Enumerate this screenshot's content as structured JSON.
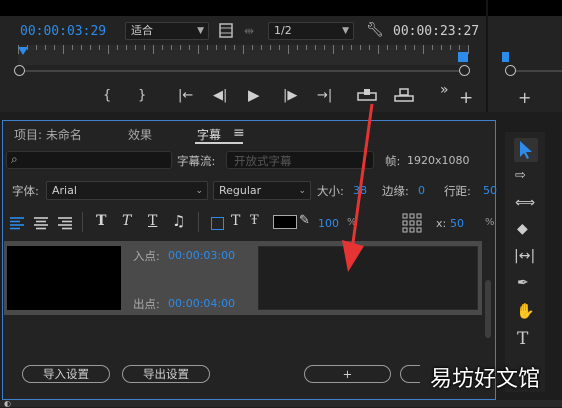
{
  "monitor": {
    "current_time": "00:00:03:29",
    "fit_select": "适合",
    "resolution_select": "1/2",
    "duration": "00:00:23:27"
  },
  "transport": {
    "mark_in": "{",
    "mark_out": "}",
    "go_to_in": "|←",
    "step_back": "◀|",
    "play": "▶",
    "step_forward": "|▶",
    "go_to_out": "→|",
    "more": "»",
    "add": "+"
  },
  "panel": {
    "tabs": [
      "项目: 未命名",
      "效果",
      "字幕"
    ],
    "menu_icon": "≡",
    "caption_stream_label": "字幕流:",
    "caption_stream_value": "开放式字幕",
    "frame_label": "帧:",
    "frame_value": "1920x1080",
    "font_label": "字体:",
    "font_value": "Arial",
    "style_value": "Regular",
    "size_label": "大小:",
    "size_value": "38",
    "edge_label": "边缘:",
    "edge_value": "0",
    "line_spacing_label": "行距:",
    "line_spacing_value": "50",
    "opacity_value": "100",
    "percent": "%",
    "x_label": "x:",
    "x_value": "50",
    "in_label": "入点:",
    "in_value": "00:00:03:00",
    "out_label": "出点:",
    "out_value": "00:00:04:00",
    "import_btn": "导入设置",
    "export_btn": "导出设置",
    "add_btn": "+"
  },
  "colors": {
    "accent": "#2d8ceb",
    "arrow": "#e63333",
    "panel_border": "#3f7fcc"
  },
  "watermark": "易坊好文馆"
}
